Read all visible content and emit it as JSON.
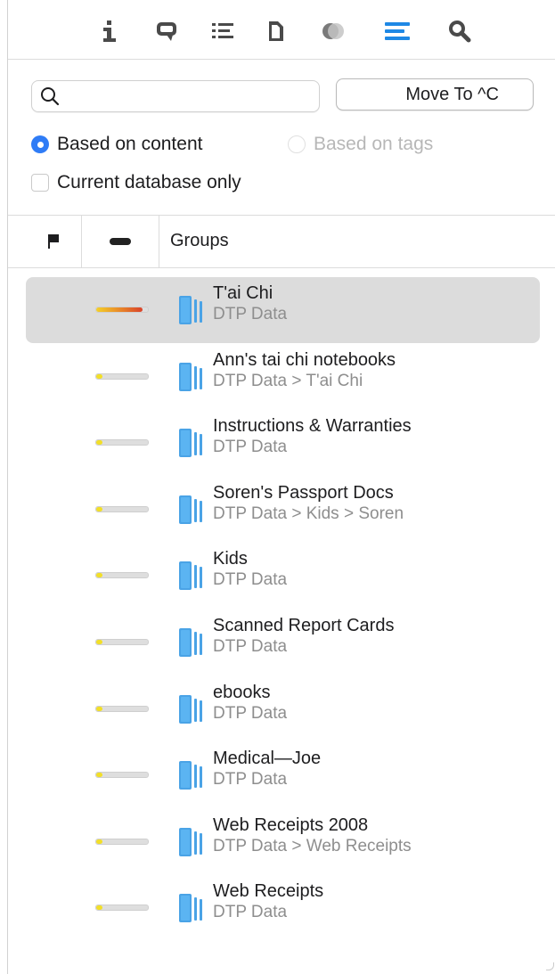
{
  "toolbar": {
    "icons": [
      "info-icon",
      "comment-icon",
      "list-icon",
      "document-icon",
      "annotation-icon",
      "see-also-icon",
      "search-icon"
    ],
    "active_color": "#1e88e5"
  },
  "search": {
    "value": "",
    "placeholder": ""
  },
  "move_button": {
    "label": "Move To ^C"
  },
  "options": {
    "based_on_content": "Based on content",
    "based_on_tags": "Based on tags",
    "current_database_only": "Current database only",
    "selected_mode": "Based on content",
    "current_database_checked": false
  },
  "columns": {
    "groups": "Groups"
  },
  "groups": [
    {
      "name": "T'ai Chi",
      "path": "DTP Data",
      "score": 0.9,
      "selected": true
    },
    {
      "name": "Ann's tai chi notebooks",
      "path": "DTP Data > T'ai Chi",
      "score": 0.12,
      "selected": false
    },
    {
      "name": "Instructions & Warranties",
      "path": "DTP Data",
      "score": 0.12,
      "selected": false
    },
    {
      "name": "Soren's Passport Docs",
      "path": "DTP Data > Kids > Soren",
      "score": 0.12,
      "selected": false
    },
    {
      "name": "Kids",
      "path": "DTP Data",
      "score": 0.12,
      "selected": false
    },
    {
      "name": "Scanned Report Cards",
      "path": "DTP Data",
      "score": 0.12,
      "selected": false
    },
    {
      "name": "ebooks",
      "path": "DTP Data",
      "score": 0.12,
      "selected": false
    },
    {
      "name": "Medical—Joe",
      "path": "DTP Data",
      "score": 0.12,
      "selected": false
    },
    {
      "name": "Web Receipts 2008",
      "path": "DTP Data > Web Receipts",
      "score": 0.12,
      "selected": false
    },
    {
      "name": "Web Receipts",
      "path": "DTP Data",
      "score": 0.12,
      "selected": false
    }
  ]
}
